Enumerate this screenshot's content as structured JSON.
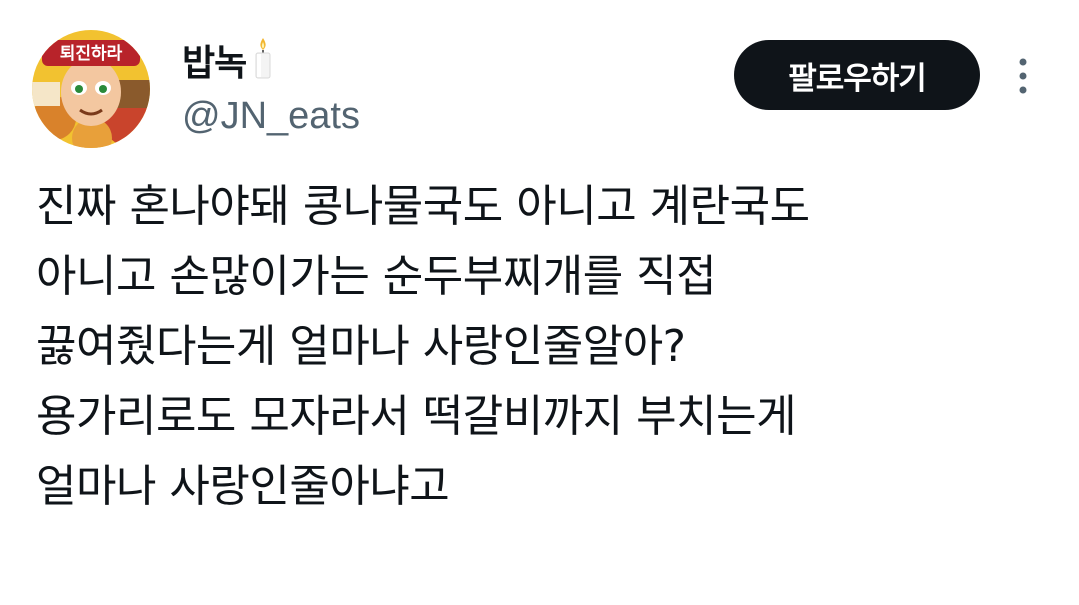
{
  "author": {
    "display_name": "밥녹",
    "handle": "@JN_eats",
    "avatar_caption": "퇴진하라"
  },
  "follow_button": {
    "label": "팔로우하기"
  },
  "more_menu": {
    "icon": "vertical-ellipsis-icon"
  },
  "tweet": {
    "lines": [
      "진짜 혼나야돼 콩나물국도 아니고 계란국도",
      "아니고 손많이가는 순두부찌개를 직접",
      "끓여줬다는게 얼마나 사랑인줄알아?",
      "용가리로도 모자라서 떡갈비까지 부치는게",
      "얼마나 사랑인줄아냐고"
    ]
  },
  "colors": {
    "text": "#0f1419",
    "secondary_text": "#536471",
    "button_bg": "#0f1419",
    "button_text": "#ffffff",
    "avatar_banner": "#b8232a"
  }
}
